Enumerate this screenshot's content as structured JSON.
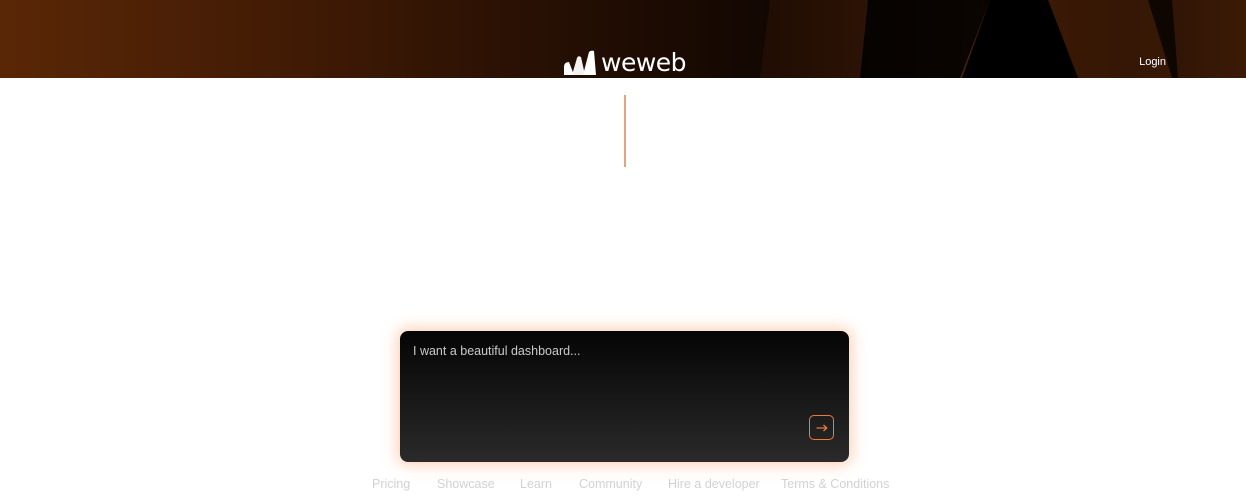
{
  "header": {
    "brand": "weweb",
    "login_label": "Login"
  },
  "prompt": {
    "placeholder": "I want a beautiful dashboard...",
    "value": "",
    "send_icon": "arrow-right-icon"
  },
  "footer": {
    "links": [
      "Pricing",
      "Showcase",
      "Learn",
      "Community",
      "Hire a developer",
      "Terms & Conditions"
    ]
  },
  "colors": {
    "accent": "#f07a35",
    "header_brown": "#5a2706",
    "card_glow": "#ff965a"
  }
}
